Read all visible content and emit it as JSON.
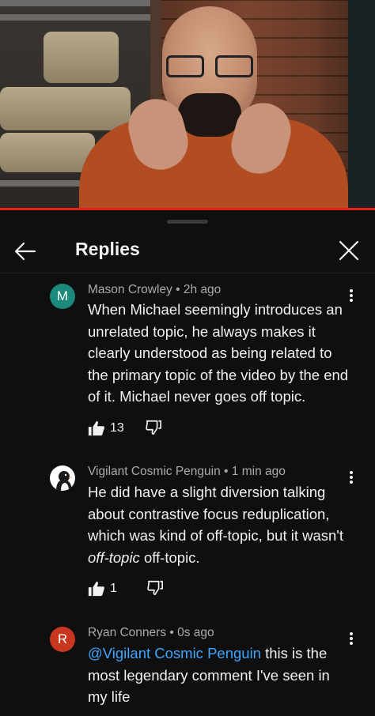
{
  "header": {
    "title": "Replies"
  },
  "comments": [
    {
      "avatar_letter": "M",
      "avatar_color": "#1b8a7c",
      "author": "Mason Crowley",
      "time": "2h ago",
      "text": "When Michael seemingly introduces an unrelated topic, he always makes it clearly understood as being related to the primary topic of the video by the end of it. Michael never goes off topic.",
      "likes": "13"
    },
    {
      "avatar_letter": "",
      "avatar_color": "#ffffff",
      "author": "Vigilant Cosmic Penguin",
      "time": "1 min ago",
      "text_before": "He did have a slight diversion talking about contrastive focus reduplication, which was kind of off-topic, but it wasn't ",
      "text_italic": "off-topic",
      "text_after": " off-topic.",
      "likes": "1"
    },
    {
      "avatar_letter": "R",
      "avatar_color": "#c8361f",
      "author": "Ryan Conners",
      "time": "0s ago",
      "mention": "@Vigilant Cosmic Penguin",
      "text": " this is the most legendary comment I've seen in my life"
    }
  ],
  "colors": {
    "progress": "#e62117",
    "mention": "#3ea6ff",
    "background": "#0f0f0f"
  },
  "icons": [
    "back-arrow-icon",
    "close-icon",
    "more-vert-icon",
    "thumb-up-icon",
    "thumb-down-icon",
    "penguin-icon"
  ]
}
